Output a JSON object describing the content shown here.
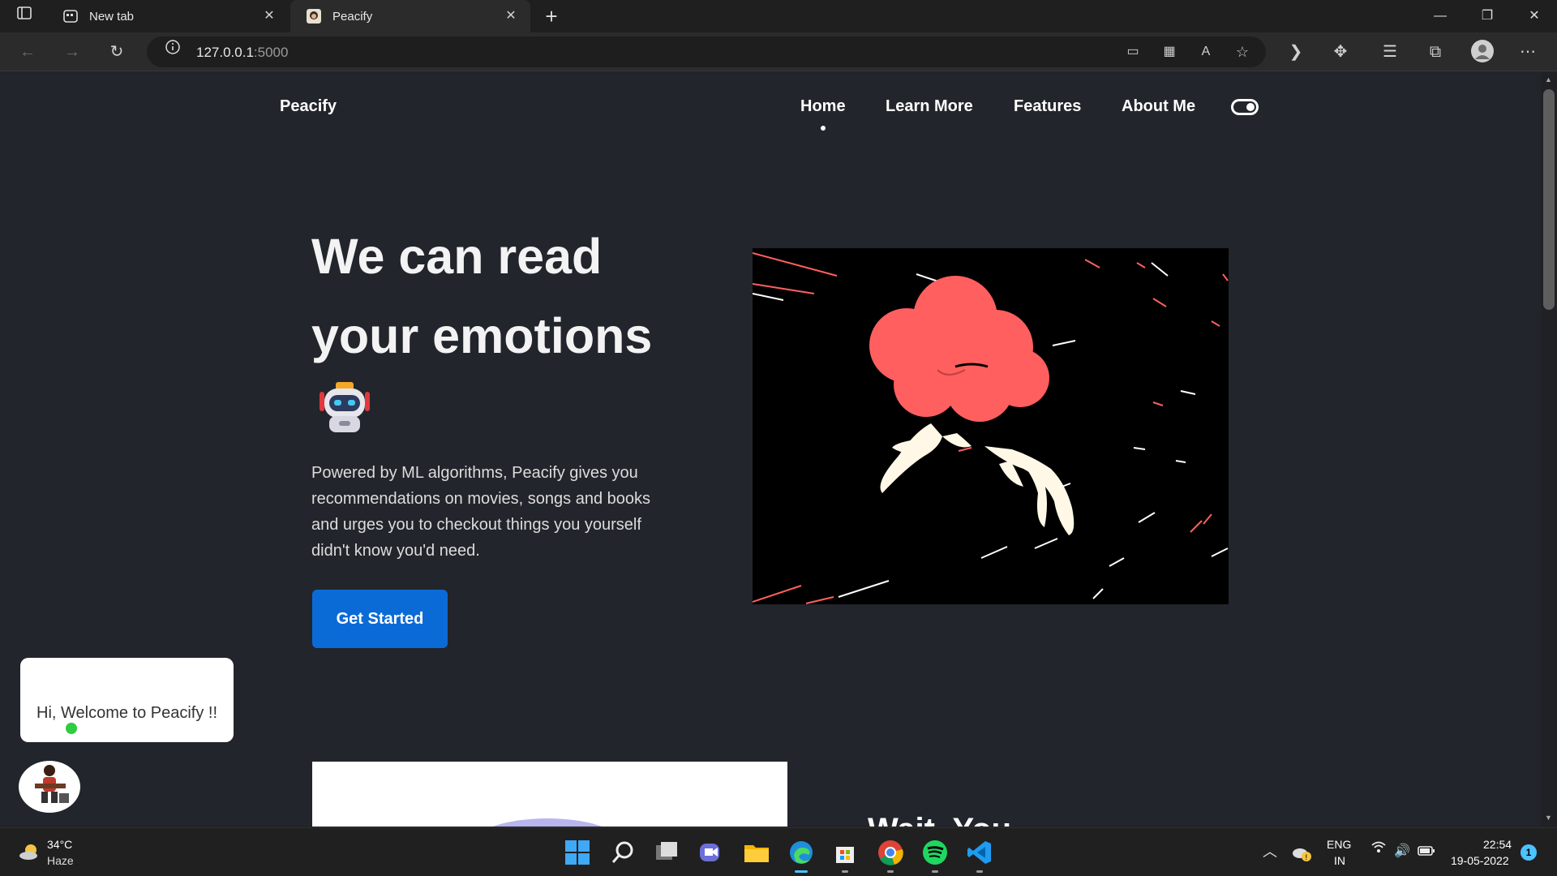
{
  "browser": {
    "tabs": [
      {
        "title": "New tab",
        "icon": "new-tab-icon"
      },
      {
        "title": "Peacify",
        "icon": "peacify-favicon",
        "active": true
      }
    ],
    "url_host": "127.0.0.1",
    "url_port": ":5000"
  },
  "navbar": {
    "brand": "Peacify",
    "links": [
      "Home",
      "Learn More",
      "Features",
      "About Me"
    ],
    "active": "Home"
  },
  "hero": {
    "title_line1": "We can read",
    "title_line2": "your emotions",
    "description": "Powered by ML algorithms, Peacify gives you recommendations on movies, songs and books and urges you to checkout things you yourself didn't know you'd need.",
    "cta": "Get Started"
  },
  "chat": {
    "welcome": "Hi, Welcome to Peacify !!"
  },
  "section2": {
    "heading_partial": "Wait, You"
  },
  "taskbar": {
    "weather_temp": "34°C",
    "weather_desc": "Haze",
    "lang_line1": "ENG",
    "lang_line2": "IN",
    "time": "22:54",
    "date": "19-05-2022",
    "notifications": "1"
  },
  "colors": {
    "page_bg": "#22252b",
    "button": "#0b6bd6",
    "brain": "#ff5f5f"
  }
}
